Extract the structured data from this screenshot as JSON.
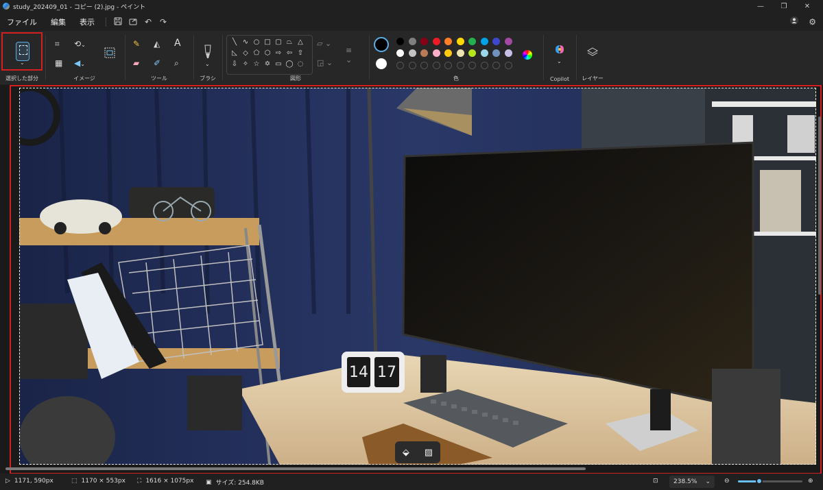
{
  "window": {
    "title": "study_202409_01 - コピー (2).jpg - ペイント",
    "controls": [
      "—",
      "❐",
      "✕"
    ]
  },
  "menu": {
    "items": [
      "ファイル",
      "編集",
      "表示"
    ]
  },
  "ribbon": {
    "groups": {
      "selection": "選択した部分",
      "image": "イメージ",
      "tools": "ツール",
      "brushes": "ブラシ",
      "shapes": "図形",
      "colors": "色",
      "copilot": "Copilot",
      "layers": "レイヤー"
    },
    "text_tool_glyph": "A",
    "colors": {
      "primary": "#000000",
      "secondary": "#ffffff",
      "row1": [
        "#000000",
        "#7f7f7f",
        "#880015",
        "#ed1c24",
        "#ff7f27",
        "#ffd800",
        "#22b14c",
        "#00a2e8",
        "#3f48cc",
        "#a349a4"
      ],
      "row2": [
        "#ffffff",
        "#c3c3c3",
        "#b97a57",
        "#ffaec9",
        "#ffc90e",
        "#efe4b0",
        "#b5e61d",
        "#99d9ea",
        "#7092be",
        "#c8bfe7"
      ]
    }
  },
  "canvas": {
    "clock_hours": "14",
    "clock_minutes": "17"
  },
  "status": {
    "cursor_position": "1171, 590px",
    "selection_size": "1170 × 553px",
    "canvas_size": "1616 × 1075px",
    "file_size": "サイズ: 254.8KB",
    "zoom": "238.5%",
    "zoom_slider_fraction": 0.33
  },
  "accent_color": "#d42020"
}
